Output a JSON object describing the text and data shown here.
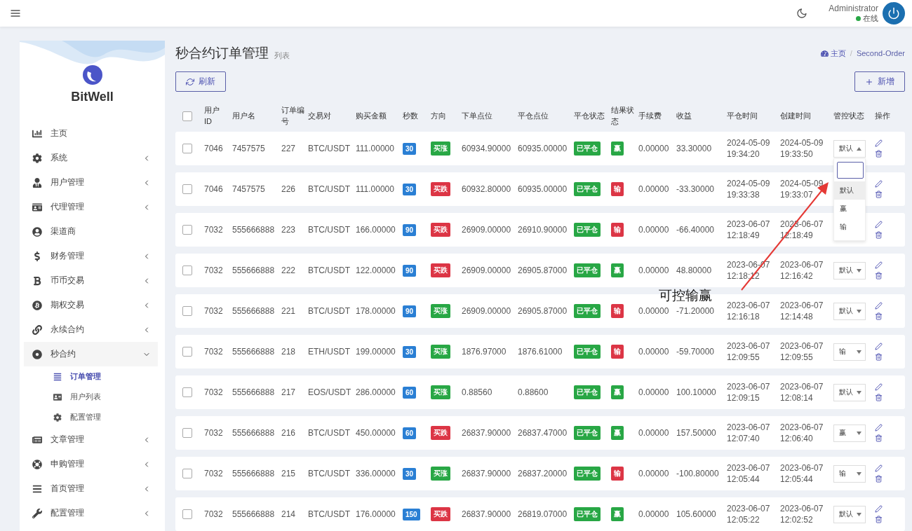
{
  "header": {
    "user_name": "Administrator",
    "status": "在线"
  },
  "sidebar": {
    "brand": "BitWell",
    "items": [
      {
        "label": "主页",
        "kind": "chart",
        "has_submenu": false
      },
      {
        "label": "系统",
        "kind": "gear",
        "has_submenu": true,
        "expanded": false
      },
      {
        "label": "用户管理",
        "kind": "user-tie",
        "has_submenu": true,
        "expanded": false
      },
      {
        "label": "代理管理",
        "kind": "id-card",
        "has_submenu": true,
        "expanded": false
      },
      {
        "label": "渠道商",
        "kind": "user-circle",
        "has_submenu": false
      },
      {
        "label": "财务管理",
        "kind": "dollar",
        "has_submenu": true,
        "expanded": false
      },
      {
        "label": "币币交易",
        "kind": "letter-b",
        "has_submenu": true,
        "expanded": false
      },
      {
        "label": "期权交易",
        "kind": "bitcoin",
        "has_submenu": true,
        "expanded": false
      },
      {
        "label": "永续合约",
        "kind": "link",
        "has_submenu": true,
        "expanded": false
      },
      {
        "label": "秒合约",
        "kind": "target",
        "has_submenu": true,
        "expanded": true,
        "children": [
          {
            "label": "订单管理",
            "kind": "list",
            "selected": true
          },
          {
            "label": "用户列表",
            "kind": "contact",
            "selected": false
          },
          {
            "label": "配置管理",
            "kind": "cog",
            "selected": false
          }
        ]
      },
      {
        "label": "文章管理",
        "kind": "newspaper",
        "has_submenu": true,
        "expanded": false
      },
      {
        "label": "申购管理",
        "kind": "lifebuoy",
        "has_submenu": true,
        "expanded": false
      },
      {
        "label": "首页管理",
        "kind": "bars",
        "has_submenu": true,
        "expanded": false
      },
      {
        "label": "配置管理",
        "kind": "wrench",
        "has_submenu": true,
        "expanded": false
      }
    ]
  },
  "page": {
    "title": "秒合约订单管理",
    "subtitle": "列表",
    "breadcrumb": {
      "items": [
        "主页",
        "Second-Order"
      ],
      "separator": "/"
    },
    "refresh_button": "刷新",
    "add_button": "新增"
  },
  "table": {
    "header_checked": false,
    "columns": [
      "用户 ID",
      "用户名",
      "订单编号",
      "交易对",
      "购买金额",
      "秒数",
      "方向",
      "下单点位",
      "平仓点位",
      "平仓状态",
      "结果状态",
      "手续费",
      "收益",
      "平仓时间",
      "创建时间",
      "管控状态",
      "操作"
    ],
    "rows": [
      {
        "checked": false,
        "user_id": "7046",
        "username": "7457575",
        "order_no": "227",
        "pair": "BTC/USDT",
        "amount": "111.00000",
        "seconds": "30",
        "direction": {
          "text": "买涨",
          "color": "#28a745"
        },
        "open_price": "60934.90000",
        "close_price": "60935.00000",
        "close_status": "已平仓",
        "result": {
          "text": "赢",
          "color": "#28a745"
        },
        "fee": "0.00000",
        "profit": "33.30000",
        "close_time": "2024-05-09 19:34:20",
        "create_time": "2024-05-09 19:33:50",
        "control": {
          "value": "默认",
          "open": true,
          "options": [
            {
              "label": "默认",
              "selected": true
            },
            {
              "label": "赢",
              "selected": false
            },
            {
              "label": "输",
              "selected": false
            }
          ]
        }
      },
      {
        "checked": false,
        "user_id": "7046",
        "username": "7457575",
        "order_no": "226",
        "pair": "BTC/USDT",
        "amount": "111.00000",
        "seconds": "30",
        "direction": {
          "text": "买跌",
          "color": "#dc3545"
        },
        "open_price": "60932.80000",
        "close_price": "60935.00000",
        "close_status": "已平仓",
        "result": {
          "text": "输",
          "color": "#dc3545"
        },
        "fee": "0.00000",
        "profit": "-33.30000",
        "close_time": "2024-05-09 19:33:38",
        "create_time": "2024-05-09 19:33:07"
      },
      {
        "checked": false,
        "user_id": "7032",
        "username": "555666888",
        "order_no": "223",
        "pair": "BTC/USDT",
        "amount": "166.00000",
        "seconds": "90",
        "direction": {
          "text": "买跌",
          "color": "#dc3545"
        },
        "open_price": "26909.00000",
        "close_price": "26910.90000",
        "close_status": "已平仓",
        "result": {
          "text": "输",
          "color": "#dc3545"
        },
        "fee": "0.00000",
        "profit": "-66.40000",
        "close_time": "2023-06-07 12:18:49",
        "create_time": "2023-06-07 12:18:49"
      },
      {
        "checked": false,
        "user_id": "7032",
        "username": "555666888",
        "order_no": "222",
        "pair": "BTC/USDT",
        "amount": "122.00000",
        "seconds": "90",
        "direction": {
          "text": "买跌",
          "color": "#dc3545"
        },
        "open_price": "26909.00000",
        "close_price": "26905.87000",
        "close_status": "已平仓",
        "result": {
          "text": "赢",
          "color": "#28a745"
        },
        "fee": "0.00000",
        "profit": "48.80000",
        "close_time": "2023-06-07 12:18:12",
        "create_time": "2023-06-07 12:16:42",
        "control": {
          "value": "默认",
          "open": false
        }
      },
      {
        "checked": false,
        "user_id": "7032",
        "username": "555666888",
        "order_no": "221",
        "pair": "BTC/USDT",
        "amount": "178.00000",
        "seconds": "90",
        "direction": {
          "text": "买涨",
          "color": "#28a745"
        },
        "open_price": "26909.00000",
        "close_price": "26905.87000",
        "close_status": "已平仓",
        "result": {
          "text": "输",
          "color": "#dc3545"
        },
        "fee": "0.00000",
        "profit": "-71.20000",
        "close_time": "2023-06-07 12:16:18",
        "create_time": "2023-06-07 12:14:48",
        "control": {
          "value": "默认",
          "open": false
        }
      },
      {
        "checked": false,
        "user_id": "7032",
        "username": "555666888",
        "order_no": "218",
        "pair": "ETH/USDT",
        "amount": "199.00000",
        "seconds": "30",
        "direction": {
          "text": "买涨",
          "color": "#28a745"
        },
        "open_price": "1876.97000",
        "close_price": "1876.61000",
        "close_status": "已平仓",
        "result": {
          "text": "输",
          "color": "#dc3545"
        },
        "fee": "0.00000",
        "profit": "-59.70000",
        "close_time": "2023-06-07 12:09:55",
        "create_time": "2023-06-07 12:09:55",
        "control": {
          "value": "输",
          "open": false
        }
      },
      {
        "checked": false,
        "user_id": "7032",
        "username": "555666888",
        "order_no": "217",
        "pair": "EOS/USDT",
        "amount": "286.00000",
        "seconds": "60",
        "direction": {
          "text": "买涨",
          "color": "#28a745"
        },
        "open_price": "0.88560",
        "close_price": "0.88600",
        "close_status": "已平仓",
        "result": {
          "text": "赢",
          "color": "#28a745"
        },
        "fee": "0.00000",
        "profit": "100.10000",
        "close_time": "2023-06-07 12:09:15",
        "create_time": "2023-06-07 12:08:14",
        "control": {
          "value": "默认",
          "open": false
        }
      },
      {
        "checked": false,
        "user_id": "7032",
        "username": "555666888",
        "order_no": "216",
        "pair": "BTC/USDT",
        "amount": "450.00000",
        "seconds": "60",
        "direction": {
          "text": "买跌",
          "color": "#dc3545"
        },
        "open_price": "26837.90000",
        "close_price": "26837.47000",
        "close_status": "已平仓",
        "result": {
          "text": "赢",
          "color": "#28a745"
        },
        "fee": "0.00000",
        "profit": "157.50000",
        "close_time": "2023-06-07 12:07:40",
        "create_time": "2023-06-07 12:06:40",
        "control": {
          "value": "赢",
          "open": false
        }
      },
      {
        "checked": false,
        "user_id": "7032",
        "username": "555666888",
        "order_no": "215",
        "pair": "BTC/USDT",
        "amount": "336.00000",
        "seconds": "30",
        "direction": {
          "text": "买涨",
          "color": "#28a745"
        },
        "open_price": "26837.90000",
        "close_price": "26837.20000",
        "close_status": "已平仓",
        "result": {
          "text": "输",
          "color": "#dc3545"
        },
        "fee": "0.00000",
        "profit": "-100.80000",
        "close_time": "2023-06-07 12:05:44",
        "create_time": "2023-06-07 12:05:44",
        "control": {
          "value": "输",
          "open": false
        }
      },
      {
        "checked": false,
        "user_id": "7032",
        "username": "555666888",
        "order_no": "214",
        "pair": "BTC/USDT",
        "amount": "176.00000",
        "seconds": "150",
        "direction": {
          "text": "买跌",
          "color": "#dc3545"
        },
        "open_price": "26837.90000",
        "close_price": "26819.07000",
        "close_status": "已平仓",
        "result": {
          "text": "赢",
          "color": "#28a745"
        },
        "fee": "0.00000",
        "profit": "105.60000",
        "close_time": "2023-06-07 12:05:22",
        "create_time": "2023-06-07 12:02:52",
        "control": {
          "value": "默认",
          "open": false
        }
      }
    ]
  },
  "annotation": {
    "text": "可控输赢"
  }
}
